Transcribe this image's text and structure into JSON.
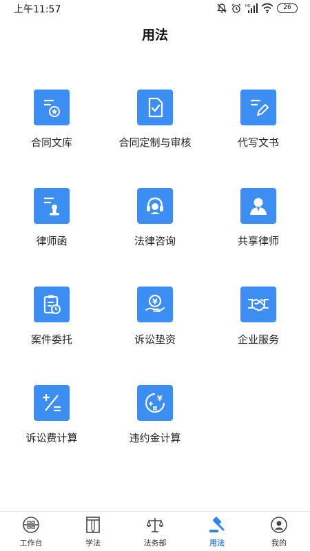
{
  "status": {
    "time": "上午11:57",
    "battery": "26"
  },
  "page": {
    "title": "用法"
  },
  "tiles": [
    {
      "label": "合同文库"
    },
    {
      "label": "合同定制与审核"
    },
    {
      "label": "代写文书"
    },
    {
      "label": "律师函"
    },
    {
      "label": "法律咨询"
    },
    {
      "label": "共享律师"
    },
    {
      "label": "案件委托"
    },
    {
      "label": "诉讼垫资"
    },
    {
      "label": "企业服务"
    },
    {
      "label": "诉讼费计算"
    },
    {
      "label": "违约金计算"
    }
  ],
  "tabs": [
    {
      "label": "工作台"
    },
    {
      "label": "学法"
    },
    {
      "label": "法务部"
    },
    {
      "label": "用法"
    },
    {
      "label": "我的"
    }
  ],
  "colors": {
    "accent": "#3d8ef3",
    "active_tab": "#2f86f0"
  }
}
